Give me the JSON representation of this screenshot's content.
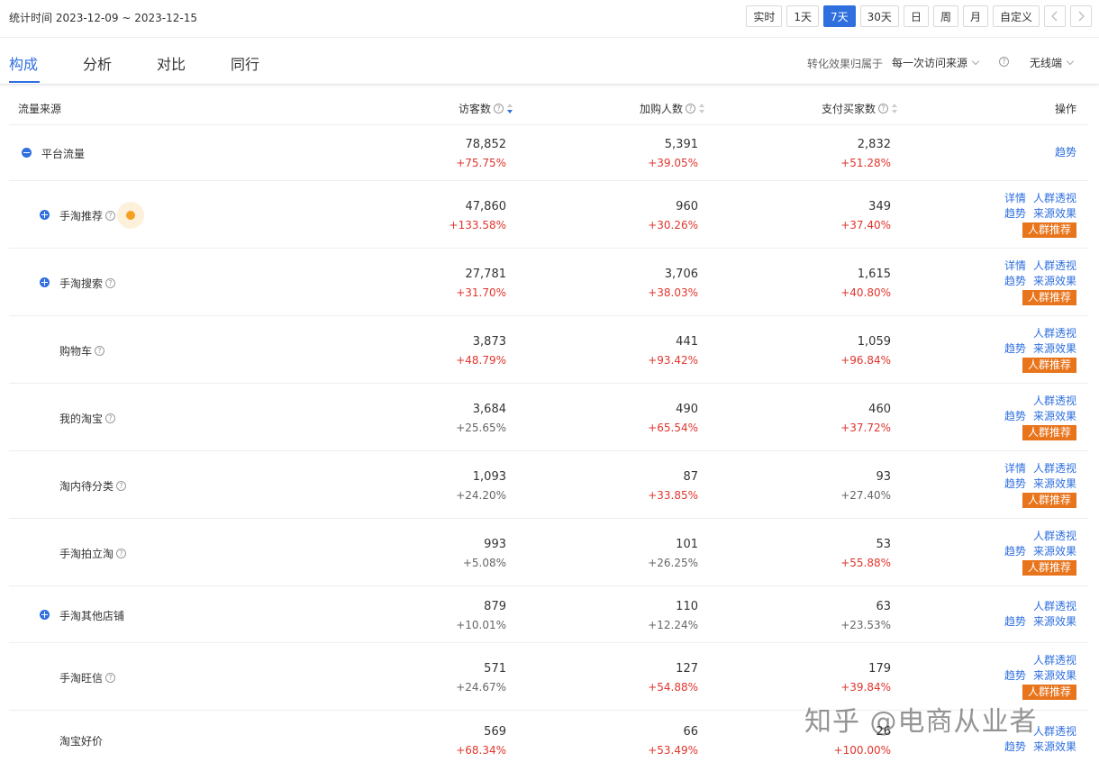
{
  "header": {
    "stat_time": "统计时间 2023-12-09 ~ 2023-12-15",
    "ranges": [
      "实时",
      "1天",
      "7天",
      "30天",
      "日",
      "周",
      "月",
      "自定义"
    ],
    "active_range": "7天",
    "prev_icon": "chevron-left-icon",
    "next_icon": "chevron-right-icon"
  },
  "tabs": {
    "items": [
      "构成",
      "分析",
      "对比",
      "同行"
    ],
    "active": "构成",
    "attribution_label": "转化效果归属于",
    "attribution_value": "每一次访问来源",
    "device_value": "无线端"
  },
  "table": {
    "columns": {
      "source": "流量来源",
      "visitors": "访客数",
      "cart": "加购人数",
      "buyers": "支付买家数",
      "ops": "操作"
    },
    "rows": [
      {
        "name": "平台流量",
        "visitors": "78,852",
        "visitors_pct": "+75.75%",
        "cart": "5,391",
        "cart_pct": "+39.05%",
        "buyers": "2,832",
        "buyers_pct": "+51.28%",
        "links": [
          "趋势"
        ]
      },
      {
        "name": "手淘推荐",
        "visitors": "47,860",
        "visitors_pct": "+133.58%",
        "cart": "960",
        "cart_pct": "+30.26%",
        "buyers": "349",
        "buyers_pct": "+37.40%",
        "links": [
          "详情",
          "人群透视",
          "趋势",
          "来源效果"
        ],
        "badge": "人群推荐"
      },
      {
        "name": "手淘搜索",
        "visitors": "27,781",
        "visitors_pct": "+31.70%",
        "cart": "3,706",
        "cart_pct": "+38.03%",
        "buyers": "1,615",
        "buyers_pct": "+40.80%",
        "links": [
          "详情",
          "人群透视",
          "趋势",
          "来源效果"
        ],
        "badge": "人群推荐"
      },
      {
        "name": "购物车",
        "visitors": "3,873",
        "visitors_pct": "+48.79%",
        "cart": "441",
        "cart_pct": "+93.42%",
        "buyers": "1,059",
        "buyers_pct": "+96.84%",
        "links": [
          "人群透视",
          "趋势",
          "来源效果"
        ],
        "badge": "人群推荐"
      },
      {
        "name": "我的淘宝",
        "visitors": "3,684",
        "visitors_pct": "+25.65%",
        "cart": "490",
        "cart_pct": "+65.54%",
        "buyers": "460",
        "buyers_pct": "+37.72%",
        "links": [
          "人群透视",
          "趋势",
          "来源效果"
        ],
        "badge": "人群推荐"
      },
      {
        "name": "淘内待分类",
        "visitors": "1,093",
        "visitors_pct": "+24.20%",
        "cart": "87",
        "cart_pct": "+33.85%",
        "buyers": "93",
        "buyers_pct": "+27.40%",
        "links": [
          "详情",
          "人群透视",
          "趋势",
          "来源效果"
        ],
        "badge": "人群推荐"
      },
      {
        "name": "手淘拍立淘",
        "visitors": "993",
        "visitors_pct": "+5.08%",
        "cart": "101",
        "cart_pct": "+26.25%",
        "buyers": "53",
        "buyers_pct": "+55.88%",
        "links": [
          "人群透视",
          "趋势",
          "来源效果"
        ],
        "badge": "人群推荐"
      },
      {
        "name": "手淘其他店铺",
        "visitors": "879",
        "visitors_pct": "+10.01%",
        "cart": "110",
        "cart_pct": "+12.24%",
        "buyers": "63",
        "buyers_pct": "+23.53%",
        "links": [
          "人群透视",
          "趋势",
          "来源效果"
        ]
      },
      {
        "name": "手淘旺信",
        "visitors": "571",
        "visitors_pct": "+24.67%",
        "cart": "127",
        "cart_pct": "+54.88%",
        "buyers": "179",
        "buyers_pct": "+39.84%",
        "links": [
          "人群透视",
          "趋势",
          "来源效果"
        ],
        "badge": "人群推荐"
      },
      {
        "name": "淘宝好价",
        "visitors": "569",
        "visitors_pct": "+68.34%",
        "cart": "66",
        "cart_pct": "+53.49%",
        "buyers": "26",
        "buyers_pct": "+100.00%",
        "links": [
          "人群透视",
          "趋势",
          "来源效果"
        ]
      }
    ]
  },
  "watermark": "知乎 @电商从业者",
  "colors": {
    "accent": "#2f6fde",
    "increase": "#e0362e",
    "badge": "#e8741c",
    "highlight_dot": "#f5a11f"
  }
}
